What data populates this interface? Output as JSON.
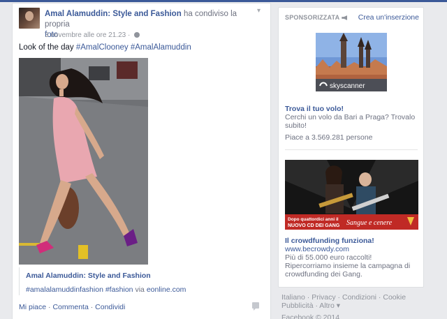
{
  "post": {
    "author": "Amal Alamuddin: Style and Fashion",
    "action": "ha condiviso la propria",
    "object": "foto",
    "timestamp": "3 novembre alle ore 21.23 ·",
    "text": "Look of the day",
    "hashtags": [
      "#AmalClooney",
      "#AmalAlamuddin"
    ],
    "preview_title": "Amal Alamuddin: Style and Fashion",
    "preview_tags": "#amalalamuddinfashion #fashion",
    "preview_via": "via",
    "preview_source": "eonline.com",
    "actions": [
      "Mi piace",
      "Commenta",
      "Condividi"
    ],
    "action_separator": "·"
  },
  "sidebar": {
    "ads_title": "SPONSORIZZATA",
    "create_ad": "Crea un'inserzione",
    "ad1": {
      "image_text": "skyscanner",
      "title": "Trova il tuo volo!",
      "body": "Cerchi un volo da Bari a Praga? Trovalo subito!",
      "likes": "Piace a 3.569.281 persone"
    },
    "ad2": {
      "image_text_top": "Dopo quattordici anni il",
      "image_text_bottom": "NUOVO CD DEI GANG",
      "image_slogan": "Sangue e cenere",
      "title": "Il crowdfunding funziona!",
      "url": "www.becrowdy.com",
      "body": "Più di 55.000 euro raccolti! Ripercorriamo insieme la campagna di crowdfunding dei Gang."
    }
  },
  "footer": {
    "links": [
      "Italiano",
      "Privacy",
      "Condizioni",
      "Cookie",
      "Pubblicità",
      "Altro ▾"
    ],
    "copyright": "Facebook © 2014"
  },
  "colors": {
    "brand": "#3b5998",
    "background": "#e9eaed",
    "muted": "#90949c"
  }
}
